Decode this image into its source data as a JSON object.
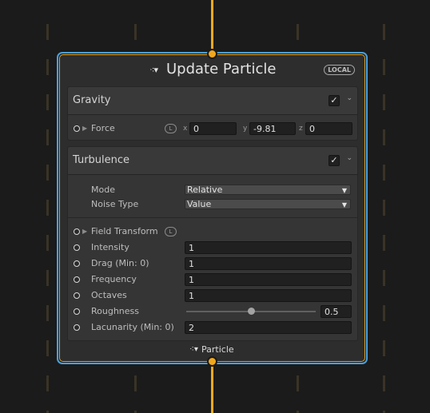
{
  "node": {
    "title": "Update Particle",
    "title_icon": "particle-system-icon",
    "space_badge": "LOCAL",
    "footer_label": "Particle"
  },
  "gravity": {
    "title": "Gravity",
    "enabled": true,
    "force": {
      "label": "Force",
      "local_badge": "L",
      "x_label": "x",
      "x_value": "0",
      "y_label": "y",
      "y_value": "-9.81",
      "z_label": "z",
      "z_value": "0"
    }
  },
  "turbulence": {
    "title": "Turbulence",
    "enabled": true,
    "mode": {
      "label": "Mode",
      "value": "Relative"
    },
    "noise_type": {
      "label": "Noise Type",
      "value": "Value"
    },
    "field_transform": {
      "label": "Field Transform",
      "local_badge": "L"
    },
    "intensity": {
      "label": "Intensity",
      "value": "1"
    },
    "drag": {
      "label": "Drag (Min: 0)",
      "value": "1"
    },
    "frequency": {
      "label": "Frequency",
      "value": "1"
    },
    "octaves": {
      "label": "Octaves",
      "value": "1"
    },
    "roughness": {
      "label": "Roughness",
      "value": "0.5",
      "fraction": 0.5
    },
    "lacunarity": {
      "label": "Lacunarity (Min: 0)",
      "value": "2"
    }
  },
  "colors": {
    "flow_edge": "#f2a81d",
    "selection": "#4aa0dc",
    "node_background": "#2d2d2d",
    "canvas_background": "#1b1b1b"
  },
  "icons": {
    "checkmark": "checkmark-icon",
    "collapse": "chevron-down-icon",
    "expand": "triangle-right-icon",
    "port": "port-dot-icon"
  }
}
